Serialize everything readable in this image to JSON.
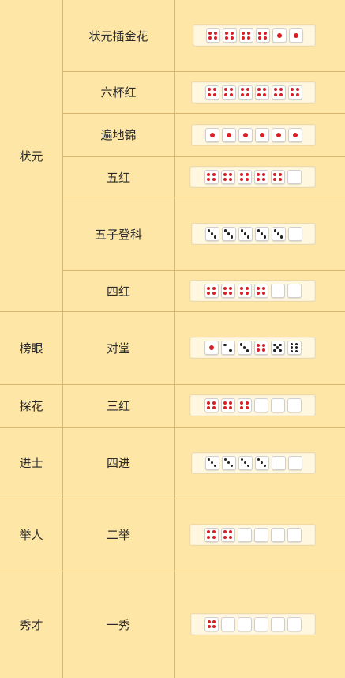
{
  "ranks": [
    {
      "label": "状元",
      "hands": [
        {
          "name": "状元插金花",
          "dice": [
            4,
            4,
            4,
            4,
            1,
            1
          ]
        },
        {
          "name": "六杯红",
          "dice": [
            4,
            4,
            4,
            4,
            4,
            4
          ]
        },
        {
          "name": "遍地锦",
          "dice": [
            1,
            1,
            1,
            1,
            1,
            1
          ]
        },
        {
          "name": "五红",
          "dice": [
            4,
            4,
            4,
            4,
            4,
            0
          ]
        },
        {
          "name": "五子登科",
          "dice": [
            3,
            3,
            3,
            3,
            3,
            0
          ]
        },
        {
          "name": "四红",
          "dice": [
            4,
            4,
            4,
            4,
            0,
            0
          ]
        }
      ]
    },
    {
      "label": "榜眼",
      "hands": [
        {
          "name": "对堂",
          "dice": [
            1,
            2,
            3,
            4,
            5,
            6
          ]
        }
      ]
    },
    {
      "label": "探花",
      "hands": [
        {
          "name": "三红",
          "dice": [
            4,
            4,
            4,
            0,
            0,
            0
          ]
        }
      ]
    },
    {
      "label": "进士",
      "hands": [
        {
          "name": "四进",
          "dice": [
            3,
            3,
            3,
            3,
            0,
            0
          ]
        }
      ]
    },
    {
      "label": "举人",
      "hands": [
        {
          "name": "二举",
          "dice": [
            4,
            4,
            0,
            0,
            0,
            0
          ]
        }
      ]
    },
    {
      "label": "秀才",
      "hands": [
        {
          "name": "一秀",
          "dice": [
            4,
            0,
            0,
            0,
            0,
            0
          ]
        }
      ]
    }
  ],
  "colors": {
    "background": "#fde6a6",
    "grid": "#d9b66d",
    "red_pip": "#d81f26",
    "black_pip": "#222222"
  }
}
